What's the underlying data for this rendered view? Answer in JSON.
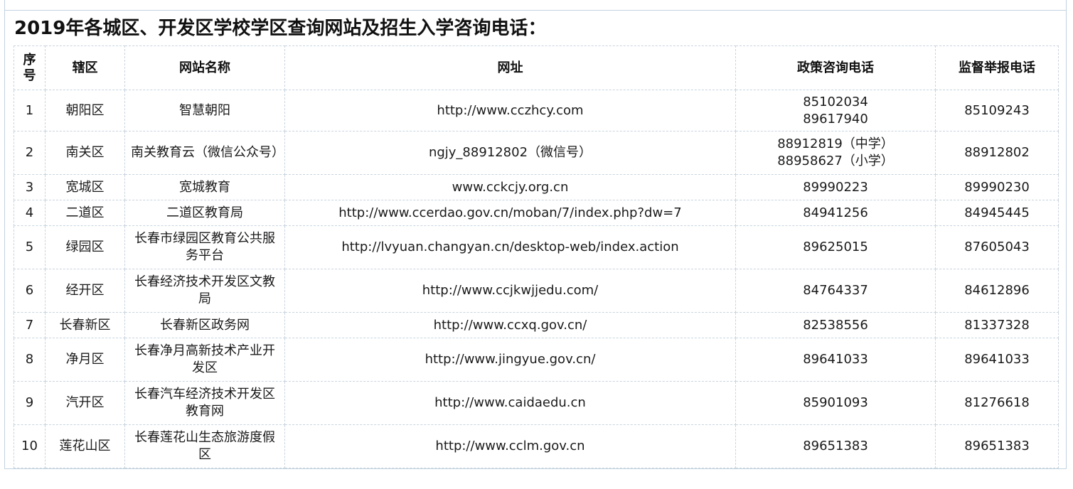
{
  "title": "2019年各城区、开发区学校学区查询网站及招生入学咨询电话：",
  "headers": {
    "no_line1": "序",
    "no_line2": "号",
    "district": "辖区",
    "site_name": "网站名称",
    "url": "网址",
    "policy_phone": "政策咨询电话",
    "report_phone": "监督举报电话"
  },
  "rows": [
    {
      "no": "1",
      "district": "朝阳区",
      "site_name": "智慧朝阳",
      "url": "http://www.cczhcy.com",
      "policy_phone_1": "85102034",
      "policy_phone_2": "89617940",
      "report_phone": "85109243"
    },
    {
      "no": "2",
      "district": "南关区",
      "site_name": "南关教育云（微信公众号）",
      "url": "ngjy_88912802（微信号）",
      "policy_phone_1": "88912819（中学）",
      "policy_phone_2": "88958627（小学）",
      "report_phone": "88912802"
    },
    {
      "no": "3",
      "district": "宽城区",
      "site_name": "宽城教育",
      "url": "www.cckcjy.org.cn",
      "policy_phone": "89990223",
      "report_phone": "89990230"
    },
    {
      "no": "4",
      "district": "二道区",
      "site_name": "二道区教育局",
      "url": "http://www.ccerdao.gov.cn/moban/7/index.php?dw=7",
      "policy_phone": "84941256",
      "report_phone": "84945445"
    },
    {
      "no": "5",
      "district": "绿园区",
      "site_name": "长春市绿园区教育公共服务平台",
      "url": "http://lvyuan.changyan.cn/desktop-web/index.action",
      "policy_phone": "89625015",
      "report_phone": "87605043"
    },
    {
      "no": "6",
      "district": "经开区",
      "site_name": "长春经济技术开发区文教局",
      "url": "http://www.ccjkwjjedu.com/",
      "policy_phone": "84764337",
      "report_phone": "84612896"
    },
    {
      "no": "7",
      "district": "长春新区",
      "site_name": "长春新区政务网",
      "url": "http://www.ccxq.gov.cn/",
      "policy_phone": "82538556",
      "report_phone": "81337328"
    },
    {
      "no": "8",
      "district": "净月区",
      "site_name": "长春净月高新技术产业开发区",
      "url": "http://www.jingyue.gov.cn/",
      "policy_phone": "89641033",
      "report_phone": "89641033"
    },
    {
      "no": "9",
      "district": "汽开区",
      "site_name": "长春汽车经济技术开发区教育网",
      "url": "http://www.caidaedu.cn",
      "policy_phone": "85901093",
      "report_phone": "81276618"
    },
    {
      "no": "10",
      "district": "莲花山区",
      "site_name": "长春莲花山生态旅游度假区",
      "url": "http://www.cclm.gov.cn",
      "policy_phone": "89651383",
      "report_phone": "89651383"
    }
  ]
}
